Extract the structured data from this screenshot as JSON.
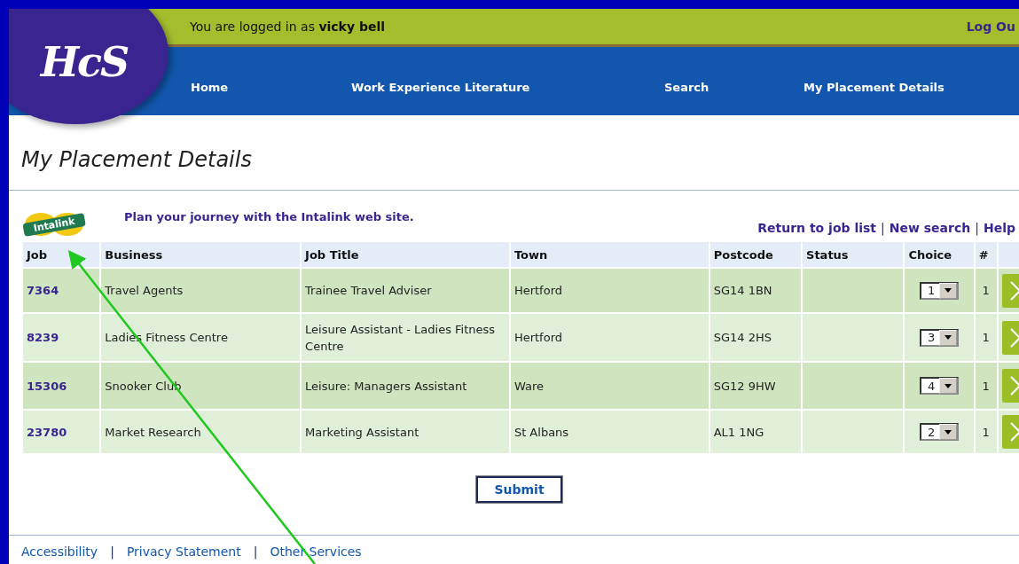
{
  "header": {
    "logo": "HcS",
    "login_text": "You are logged in as **vicky bell**",
    "logout": "Log Ou",
    "nav": [
      "Home",
      "Work Experience Literature",
      "Search",
      "My Placement Details"
    ]
  },
  "page_title": "My Placement Details",
  "journey": {
    "logo": "Intalink",
    "text": "Plan your journey with the Intalink web site."
  },
  "links": [
    {
      "kind": "link",
      "text": "Return to job list"
    },
    {
      "kind": "separator",
      "text": "|"
    },
    {
      "kind": "link",
      "text": "New search"
    },
    {
      "kind": "separator",
      "text": "|"
    },
    {
      "kind": "link",
      "text": "Help"
    }
  ],
  "table": {
    "columns": [
      "Job",
      "Business",
      "Job Title",
      "Town",
      "Postcode",
      "Status",
      "Choice",
      "#"
    ],
    "rows": [
      {
        "job": "7364",
        "business": "Travel Agents",
        "job_title": "Trainee Travel Adviser",
        "town": "Hertford",
        "postcode": "SG14 1BN",
        "choice": "1",
        "count": "1"
      },
      {
        "job": "8239",
        "business": "Ladies Fitness Centre",
        "job_title": "Leisure Assistant - Ladies Fitness Centre",
        "town": "Hertford",
        "postcode": "SG14 2HS",
        "choice": "3",
        "count": "1"
      },
      {
        "job": "15306",
        "business": "Snooker Club",
        "job_title": "Leisure: Managers Assistant",
        "town": "Ware",
        "postcode": "SG12 9HW",
        "choice": "4",
        "count": "1"
      },
      {
        "job": "23780",
        "business": "Market Research",
        "job_title": "Marketing Assistant",
        "town": "St Albans",
        "postcode": "AL1 1NG",
        "choice": "2",
        "count": "1"
      }
    ]
  },
  "submit": "Submit",
  "footer": [
    {
      "kind": "link",
      "text": "Accessibility"
    },
    {
      "kind": "separator",
      "text": "|"
    },
    {
      "kind": "link",
      "text": "Privacy Statement"
    },
    {
      "kind": "separator",
      "text": "|"
    },
    {
      "kind": "link",
      "text": "Other Services"
    }
  ]
}
